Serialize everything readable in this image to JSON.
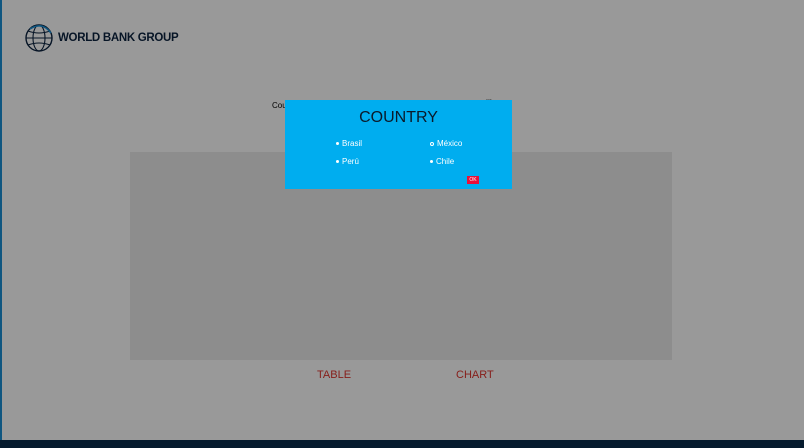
{
  "brand": {
    "logo_text": "WORLD BANK GROUP"
  },
  "background": {
    "label_left": "Cou",
    "label_right": "...",
    "tabs": [
      {
        "label": "TABLE"
      },
      {
        "label": "CHART"
      }
    ]
  },
  "dialog": {
    "title": "COUNTRY",
    "options": [
      {
        "label": "Brasil",
        "selected": true
      },
      {
        "label": "México",
        "selected": false
      },
      {
        "label": "Perú",
        "selected": true
      },
      {
        "label": "Chile",
        "selected": true
      }
    ],
    "ok_label": "OK"
  },
  "colors": {
    "accent": "#00adef",
    "ok_button": "#e8103a",
    "tab_text": "#e0352e",
    "footer": "#0b2d4e"
  }
}
